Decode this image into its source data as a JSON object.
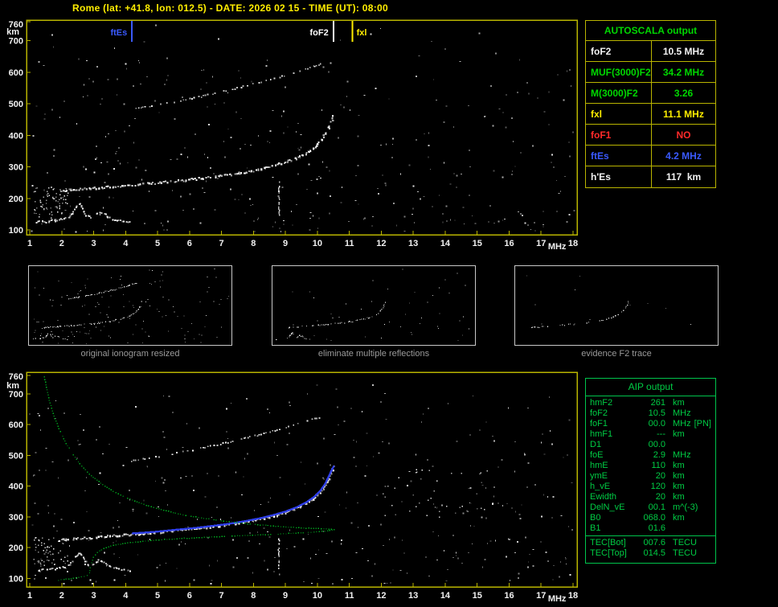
{
  "header": {
    "title": "Rome (lat: +41.8, lon: 012.5) - DATE: 2026 02 15 - TIME (UT): 08:00"
  },
  "colors": {
    "background": "#000000",
    "title_yellow": "#ffee00",
    "axis_border_yellow": "#b9b400",
    "axis_text_white": "#f2f2f2",
    "trace_white": "#ffffff",
    "marker_blue": "#3a5aff",
    "marker_white": "#ffffff",
    "marker_yellow": "#ffee00",
    "autoscala_green": "#00d800",
    "autoscala_red": "#ff2a2a",
    "aip_green": "#00cc44",
    "profile_green": "#00bb22",
    "fitted_blue": "#2f3fe8",
    "caption_gray": "#9a9a9a"
  },
  "autoscala_table": {
    "title": "AUTOSCALA output",
    "rows": [
      {
        "label": "foF2",
        "value": "10.5 MHz",
        "color": "#f2f2f2"
      },
      {
        "label": "MUF(3000)F2",
        "value": "34.2 MHz",
        "color": "#00d800"
      },
      {
        "label": "M(3000)F2",
        "value": "3.26",
        "color": "#00d800"
      },
      {
        "label": "fxl",
        "value": "11.1 MHz",
        "color": "#ffee00"
      },
      {
        "label": "foF1",
        "value": "NO",
        "color": "#ff2a2a"
      },
      {
        "label": "ftEs",
        "value": "4.2 MHz",
        "color": "#3a5aff"
      },
      {
        "label": "h'Es",
        "value": "117  km",
        "color": "#f2f2f2"
      }
    ]
  },
  "thumbnails": [
    {
      "caption": "original ionogram resized",
      "series": [
        "es_layer",
        "f2_ordinary",
        "f2_second_hop"
      ],
      "noise": 140,
      "seed": 5,
      "keep": 0.75,
      "f_min": 1
    },
    {
      "caption": "eliminate multiple reflections",
      "series": [
        "es_layer",
        "f2_ordinary"
      ],
      "noise": 45,
      "seed": 9,
      "keep": 0.6,
      "f_min": 1
    },
    {
      "caption": "evidence F2 trace",
      "series": [
        "f2_ordinary"
      ],
      "noise": 10,
      "seed": 13,
      "keep": 0.45,
      "f_min": 2.2
    }
  ],
  "aip_table": {
    "title": "AIP output",
    "rows": [
      {
        "name": "hmF2",
        "value": "261",
        "unit": "km",
        "note": ""
      },
      {
        "name": "foF2",
        "value": "10.5",
        "unit": "MHz",
        "note": ""
      },
      {
        "name": "foF1",
        "value": "00.0",
        "unit": "MHz",
        "note": "[PN]"
      },
      {
        "name": "hmF1",
        "value": "---",
        "unit": "km",
        "note": ""
      },
      {
        "name": "D1",
        "value": "00.0",
        "unit": "",
        "note": ""
      },
      {
        "name": "foE",
        "value": "2.9",
        "unit": "MHz",
        "note": ""
      },
      {
        "name": "hmE",
        "value": "110",
        "unit": "km",
        "note": ""
      },
      {
        "name": "ymE",
        "value": "20",
        "unit": "km",
        "note": ""
      },
      {
        "name": "h_vE",
        "value": "120",
        "unit": "km",
        "note": ""
      },
      {
        "name": "Ewidth",
        "value": "20",
        "unit": "km",
        "note": ""
      },
      {
        "name": "DelN_vE",
        "value": "00.1",
        "unit": "m^(-3)",
        "note": ""
      },
      {
        "name": "B0",
        "value": "068.0",
        "unit": "km",
        "note": ""
      },
      {
        "name": "B1",
        "value": "01.6",
        "unit": "",
        "note": ""
      }
    ],
    "tec_rows": [
      {
        "name": "TEC[Bot]",
        "value": "007.6",
        "unit": "TECU",
        "note": ""
      },
      {
        "name": "TEC[Top]",
        "value": "014.5",
        "unit": "TECU",
        "note": ""
      }
    ]
  },
  "traces": {
    "es_layer": [
      [
        1.2,
        126
      ],
      [
        1.35,
        131
      ],
      [
        1.5,
        128
      ],
      [
        1.65,
        134
      ],
      [
        1.8,
        131
      ],
      [
        1.95,
        136
      ],
      [
        2.1,
        139
      ],
      [
        2.25,
        147
      ],
      [
        2.38,
        163
      ],
      [
        2.48,
        180
      ],
      [
        2.56,
        184
      ],
      [
        2.64,
        172
      ],
      [
        2.74,
        150
      ],
      [
        2.88,
        142
      ],
      [
        3.02,
        149
      ],
      [
        3.14,
        160
      ],
      [
        3.28,
        156
      ],
      [
        3.42,
        144
      ],
      [
        3.56,
        137
      ],
      [
        3.72,
        133
      ],
      [
        3.88,
        130
      ],
      [
        4.05,
        127
      ],
      [
        4.15,
        125
      ]
    ],
    "f2_ordinary": [
      [
        1.9,
        226
      ],
      [
        2.2,
        229
      ],
      [
        2.55,
        232
      ],
      [
        2.9,
        234
      ],
      [
        3.25,
        237
      ],
      [
        3.6,
        240
      ],
      [
        3.95,
        243
      ],
      [
        4.3,
        246
      ],
      [
        4.65,
        249
      ],
      [
        5.0,
        252
      ],
      [
        5.4,
        256
      ],
      [
        5.8,
        260
      ],
      [
        6.2,
        264
      ],
      [
        6.6,
        269
      ],
      [
        7.0,
        274
      ],
      [
        7.4,
        280
      ],
      [
        7.8,
        287
      ],
      [
        8.2,
        295
      ],
      [
        8.6,
        305
      ],
      [
        9.0,
        317
      ],
      [
        9.35,
        331
      ],
      [
        9.65,
        347
      ],
      [
        9.9,
        365
      ],
      [
        10.1,
        386
      ],
      [
        10.25,
        408
      ],
      [
        10.35,
        430
      ],
      [
        10.43,
        452
      ],
      [
        10.48,
        470
      ]
    ],
    "f2_second_hop": [
      [
        4.15,
        484
      ],
      [
        4.45,
        489
      ],
      [
        4.8,
        495
      ],
      [
        5.15,
        501
      ],
      [
        5.5,
        508
      ],
      [
        5.85,
        515
      ],
      [
        6.2,
        522
      ],
      [
        6.55,
        530
      ],
      [
        6.9,
        538
      ],
      [
        7.25,
        546
      ],
      [
        7.6,
        555
      ],
      [
        7.95,
        564
      ],
      [
        8.3,
        573
      ],
      [
        8.65,
        583
      ],
      [
        9.0,
        593
      ],
      [
        9.3,
        602
      ],
      [
        9.6,
        611
      ],
      [
        9.9,
        621
      ],
      [
        10.15,
        630
      ]
    ],
    "fitted_f2": [
      [
        4.2,
        246
      ],
      [
        4.65,
        249
      ],
      [
        5.0,
        252
      ],
      [
        5.4,
        256
      ],
      [
        5.8,
        260
      ],
      [
        6.2,
        264
      ],
      [
        6.6,
        269
      ],
      [
        7.0,
        274
      ],
      [
        7.4,
        280
      ],
      [
        7.8,
        287
      ],
      [
        8.2,
        295
      ],
      [
        8.6,
        305
      ],
      [
        9.0,
        317
      ],
      [
        9.35,
        331
      ],
      [
        9.65,
        347
      ],
      [
        9.9,
        365
      ],
      [
        10.1,
        386
      ],
      [
        10.25,
        408
      ],
      [
        10.35,
        430
      ],
      [
        10.45,
        452
      ],
      [
        10.52,
        466
      ]
    ],
    "density_profile": [
      [
        1.45,
        757
      ],
      [
        1.52,
        715
      ],
      [
        1.62,
        672
      ],
      [
        1.74,
        630
      ],
      [
        1.9,
        588
      ],
      [
        2.08,
        548
      ],
      [
        2.3,
        510
      ],
      [
        2.55,
        474
      ],
      [
        2.85,
        441
      ],
      [
        3.2,
        411
      ],
      [
        3.6,
        385
      ],
      [
        4.05,
        362
      ],
      [
        4.55,
        342
      ],
      [
        5.1,
        325
      ],
      [
        5.7,
        310
      ],
      [
        6.35,
        298
      ],
      [
        7.05,
        288
      ],
      [
        7.8,
        279
      ],
      [
        8.6,
        272
      ],
      [
        9.4,
        266
      ],
      [
        10.1,
        263
      ],
      [
        10.5,
        261
      ],
      [
        10.3,
        256
      ],
      [
        9.7,
        251
      ],
      [
        9.0,
        247
      ],
      [
        8.2,
        243
      ],
      [
        7.4,
        240
      ],
      [
        6.6,
        236
      ],
      [
        5.9,
        232
      ],
      [
        5.2,
        228
      ],
      [
        4.6,
        223
      ],
      [
        4.05,
        217
      ],
      [
        3.6,
        209
      ],
      [
        3.3,
        199
      ],
      [
        3.1,
        186
      ],
      [
        2.98,
        170
      ],
      [
        2.92,
        152
      ],
      [
        2.88,
        135
      ],
      [
        2.85,
        120
      ],
      [
        2.78,
        111
      ],
      [
        2.6,
        106
      ],
      [
        2.35,
        102
      ],
      [
        2.05,
        98
      ],
      [
        1.8,
        94
      ]
    ]
  },
  "chart_data": [
    {
      "type": "scatter",
      "title": "scaled ionogram with autoscala characteristics",
      "xlabel": "MHz",
      "ylabel": "km",
      "xlim": [
        1,
        18
      ],
      "ylim": [
        85,
        760
      ],
      "x_ticks": [
        1,
        2,
        3,
        4,
        5,
        6,
        7,
        8,
        9,
        10,
        11,
        12,
        13,
        14,
        15,
        16,
        17,
        18
      ],
      "y_ticks": [
        100,
        200,
        300,
        400,
        500,
        600,
        700,
        760
      ],
      "grid": false,
      "markers": [
        {
          "label": "ftEs",
          "x": 4.2,
          "color": "#3a5aff",
          "label_side": "left"
        },
        {
          "label": "foF2",
          "x": 10.5,
          "color": "#ffffff",
          "label_side": "left"
        },
        {
          "label": "fxl",
          "x": 11.1,
          "color": "#ffee00",
          "label_side": "right"
        }
      ],
      "series": [
        "es_layer",
        "f2_ordinary",
        "f2_second_hop"
      ],
      "overlays": [],
      "noise": {
        "seed": 11,
        "count": 380,
        "clusters": [
          {
            "f1": 1.1,
            "f2": 2.2,
            "h1": 140,
            "h2": 235,
            "count": 70
          }
        ],
        "columns": [
          {
            "f": 8.78,
            "h1": 150,
            "h2": 255
          }
        ]
      }
    },
    {
      "type": "scatter",
      "title": "ionogram with restored trace and electron density profile",
      "xlabel": "MHz",
      "ylabel": "km",
      "xlim": [
        1,
        18
      ],
      "ylim": [
        85,
        760
      ],
      "x_ticks": [
        1,
        2,
        3,
        4,
        5,
        6,
        7,
        8,
        9,
        10,
        11,
        12,
        13,
        14,
        15,
        16,
        17,
        18
      ],
      "y_ticks": [
        100,
        200,
        300,
        400,
        500,
        600,
        700,
        760
      ],
      "grid": false,
      "markers": [],
      "series": [
        "es_layer",
        "f2_ordinary",
        "f2_second_hop"
      ],
      "overlays": [
        {
          "name": "fitted_f2",
          "color": "#2f3fe8",
          "style": "line"
        },
        {
          "name": "density_profile",
          "color": "#00bb22",
          "style": "dotted"
        }
      ],
      "noise": {
        "seed": 23,
        "count": 380,
        "clusters": [
          {
            "f1": 1.1,
            "f2": 2.2,
            "h1": 140,
            "h2": 235,
            "count": 60
          },
          {
            "f1": 12.0,
            "f2": 15.5,
            "h1": 300,
            "h2": 460,
            "count": 40
          }
        ],
        "columns": [
          {
            "f": 8.78,
            "h1": 110,
            "h2": 235
          }
        ]
      }
    }
  ]
}
